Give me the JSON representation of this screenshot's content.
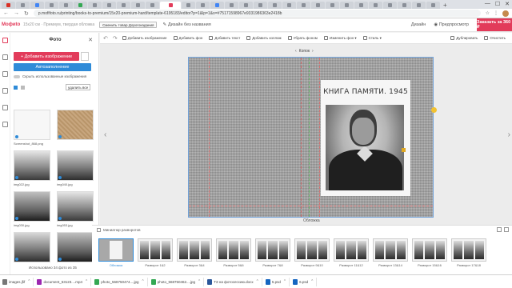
{
  "browser": {
    "url": "p.mofifoto.ru/printing/books-to-premium/15x20-premium-hard/template-6195183/editor?p=1&lp=1&o=#75171598967e9331986363e2418b",
    "window_controls": [
      "—",
      "☐",
      "✕"
    ],
    "new_tab": "+"
  },
  "app": {
    "logo": "Мофиto",
    "product_size": "15x20 см · Премиум, твердая обложка",
    "change_product_label": "Сменить товар  Дорогоиздания",
    "project_title": "Дизайн без названия",
    "design_menu": "Дизайн",
    "preview_label": "Предпросмотр",
    "order_label": "Заказать за 360 ₽"
  },
  "left_panel": {
    "title": "Фото",
    "close": "✕",
    "add_images": "+  Добавить изображение",
    "autofill": "Автозаполнение",
    "hide_used": "Скрыть использованные изображения",
    "delete_all": "удалить все",
    "photos": [
      {
        "caption": "Screenshot_868.png",
        "style": "white"
      },
      {
        "caption": "",
        "style": "burlap"
      },
      {
        "caption": "img022.jpg",
        "style": "photo"
      },
      {
        "caption": "img040.jpg",
        "style": "photo2"
      },
      {
        "caption": "img030.jpg",
        "style": "photo3"
      },
      {
        "caption": "img053.jpg",
        "style": "photo"
      },
      {
        "caption": "",
        "style": "photo2"
      },
      {
        "caption": "",
        "style": "photo3"
      }
    ],
    "footer_count": "Использовано 34 фото из 35"
  },
  "toolbar": {
    "undo": "↶",
    "redo": "↷",
    "items": [
      "Добавить изображение",
      "Добавить фон",
      "Добавить текст",
      "Добавить коллаж",
      "Убрать фоном",
      "Изменить фон ▾",
      "Стиль ▾"
    ],
    "right_items": [
      "Дублировать",
      "Очистить"
    ]
  },
  "canvas": {
    "spread_nav": "Копок",
    "spread_nav_left": "‹",
    "spread_nav_right": "›",
    "prev": "‹",
    "next": "›",
    "memory_title": "КНИГА ПАМЯТИ. 1945",
    "label": "Обложка"
  },
  "strip": {
    "minimap_label": "Миниатюр разворотов",
    "spreads": [
      {
        "caption": "Обложка",
        "active": true
      },
      {
        "caption": "Разворот 1&2",
        "active": false
      },
      {
        "caption": "Разворот 3&4",
        "active": false
      },
      {
        "caption": "Разворот 5&6",
        "active": false
      },
      {
        "caption": "Разворот 7&8",
        "active": false
      },
      {
        "caption": "Разворот 9&10",
        "active": false
      },
      {
        "caption": "Разворот 11&12",
        "active": false
      },
      {
        "caption": "Разворот 13&14",
        "active": false
      },
      {
        "caption": "Разворот 15&16",
        "active": false
      },
      {
        "caption": "Разворот 17&18",
        "active": false
      }
    ]
  },
  "downloads": [
    {
      "name": "images.jfif",
      "kind": "jfif"
    },
    {
      "name": "document_53123....mp4",
      "kind": "mp4"
    },
    {
      "name": "photo_568750474....jpg",
      "kind": "img"
    },
    {
      "name": "photo_568750462....jpg",
      "kind": "img"
    },
    {
      "name": "ТЗ на фотосессию.docx",
      "kind": "doc"
    },
    {
      "name": "5.psd",
      "kind": "psd"
    },
    {
      "name": "6.psd",
      "kind": "psd"
    }
  ],
  "colors": {
    "accent": "#e23b5a",
    "primary_blue": "#2f8bd8",
    "selection_handle": "#f2c230"
  }
}
